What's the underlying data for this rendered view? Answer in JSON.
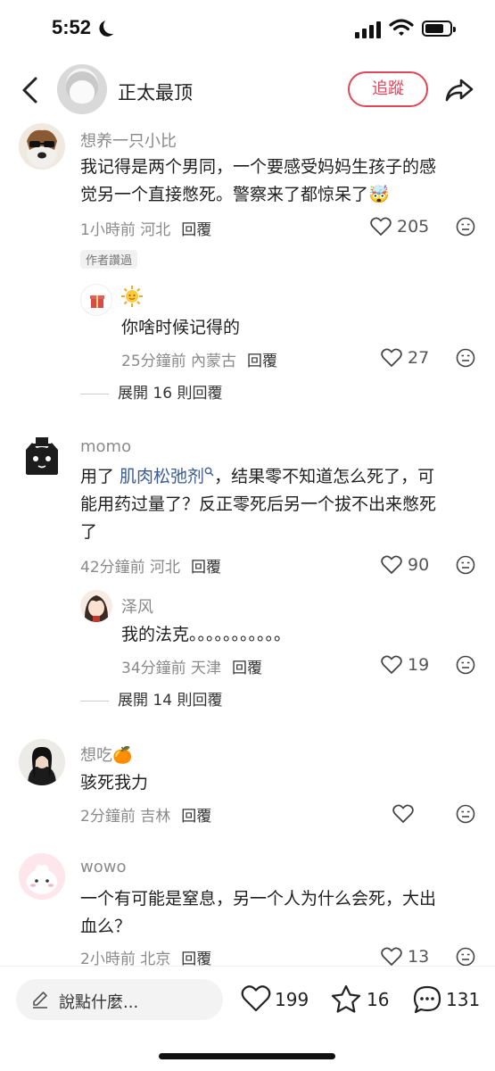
{
  "status_bar": {
    "time": "5:52"
  },
  "header": {
    "user_name": "正太最顶",
    "follow_label": "追蹤"
  },
  "comments": [
    {
      "user": "想养一只小比",
      "text_line1": "我记得是两个男同，一个要感受妈妈生孩子的感",
      "text_line2": "觉另一个直接憋死。警察来了都惊呆了🤯",
      "meta": "1小時前 河北",
      "reply_label": "回覆",
      "likes": "205",
      "author_tag": "作者讚過",
      "reply": {
        "user": "🌞",
        "text": "你啥时候记得的",
        "meta": "25分鐘前 內蒙古",
        "reply_label": "回覆",
        "likes": "27"
      },
      "expand_label": "展開 16 則回覆"
    },
    {
      "user": "momo",
      "text_prefix": "用了 ",
      "text_link": "肌肉松弛剂",
      "text_rest": "，结果零不知道怎么死了，可",
      "text_line2": "能用药过量了？反正零死后另一个拔不出来憋死",
      "text_line3": "了",
      "meta": "42分鐘前 河北",
      "reply_label": "回覆",
      "likes": "90",
      "reply": {
        "user": "泽风",
        "text": "我的法克。。。。。。。。。。。",
        "meta": "34分鐘前 天津",
        "reply_label": "回覆",
        "likes": "19"
      },
      "expand_label": "展開 14 則回覆"
    },
    {
      "user": "想吃🍊",
      "text": "骇死我力",
      "meta": "2分鐘前 吉林",
      "reply_label": "回覆"
    },
    {
      "user": "wowo",
      "text_line1": "一个有可能是窒息，另一个人为什么会死，大出",
      "text_line2": "血么？",
      "meta": "2小時前 北京",
      "reply_label": "回覆",
      "likes": "13"
    }
  ],
  "bottom_bar": {
    "input_placeholder": "說點什麼...",
    "likes": "199",
    "stars": "16",
    "comments": "131"
  },
  "colors": {
    "accent": "#e0465a",
    "link": "#3a5b91",
    "muted": "#8a8a8a"
  }
}
